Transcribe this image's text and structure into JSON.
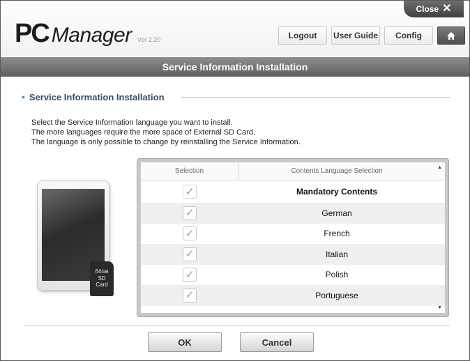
{
  "header": {
    "logo_pc": "PC",
    "logo_manager": "Manager",
    "version": "Ver 2.20",
    "close_label": "Close",
    "logout_label": "Logout",
    "guide_label": "User Guide",
    "config_label": "Config",
    "home_icon": "home-icon"
  },
  "titlebar": {
    "title": "Service Information Installation"
  },
  "section": {
    "title": "Service Information Installation",
    "lines": [
      "Select the Service Information language you want to install.",
      "The more languages  require the more space of External SD Card.",
      "The language is only possible to change by reinstalling  the Service Information."
    ]
  },
  "sdcard": {
    "capacity": "64",
    "capacity_unit": "GB",
    "line1": "SD",
    "line2": "Card"
  },
  "table": {
    "col_selection": "Selection",
    "col_language": "Contents Language Selection",
    "rows": [
      {
        "label": "Mandatory Contents",
        "checked": true,
        "mandatory": true
      },
      {
        "label": "German",
        "checked": true
      },
      {
        "label": "French",
        "checked": true
      },
      {
        "label": "Italian",
        "checked": true
      },
      {
        "label": "Polish",
        "checked": true
      },
      {
        "label": "Portuguese",
        "checked": true
      }
    ],
    "check_glyph": "✓"
  },
  "footer": {
    "ok_label": "OK",
    "cancel_label": "Cancel"
  },
  "colors": {
    "accent_blue": "#4a90c8",
    "mandatory_check": "#8fc97a",
    "titlebar": "#6f6f6f"
  }
}
